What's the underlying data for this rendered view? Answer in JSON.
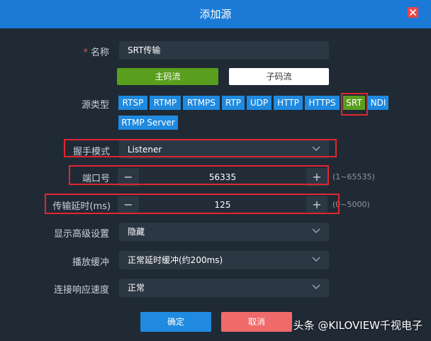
{
  "dialog": {
    "title": "添加源",
    "close_icon": "close-icon"
  },
  "name": {
    "required_mark": "*",
    "label": "名称",
    "value": "SRT传输"
  },
  "stream_tabs": {
    "main": "主码流",
    "sub": "子码流",
    "selected": "main"
  },
  "source_type": {
    "label": "源类型",
    "options": [
      "RTSP",
      "RTMP",
      "RTMPS",
      "RTP",
      "UDP",
      "HTTP",
      "HTTPS",
      "SRT",
      "NDI",
      "RTMP Server"
    ],
    "selected": "SRT"
  },
  "handshake_mode": {
    "label": "握手模式",
    "value": "Listener"
  },
  "port": {
    "label": "端口号",
    "value": "56335",
    "minus": "−",
    "plus": "+",
    "range_hint": "(1~65535)"
  },
  "latency": {
    "label": "传输延时(ms)",
    "value": "125",
    "minus": "−",
    "plus": "+",
    "range_hint": "(0~5000)"
  },
  "advanced": {
    "label": "显示高级设置",
    "value": "隐藏"
  },
  "buffer": {
    "label": "播放缓冲",
    "value": "正常延时缓冲(约200ms)"
  },
  "response": {
    "label": "连接响应速度",
    "value": "正常"
  },
  "footer": {
    "ok": "确定",
    "cancel": "取消"
  },
  "watermark": {
    "text": "头条 @KILOVIEW千视电子"
  },
  "colors": {
    "titlebar": "#1a7ad6",
    "accent_blue": "#1f8ae0",
    "selected_green": "#5a9e1e",
    "highlight_red": "#e0262f",
    "cancel_red": "#f06a6a"
  }
}
